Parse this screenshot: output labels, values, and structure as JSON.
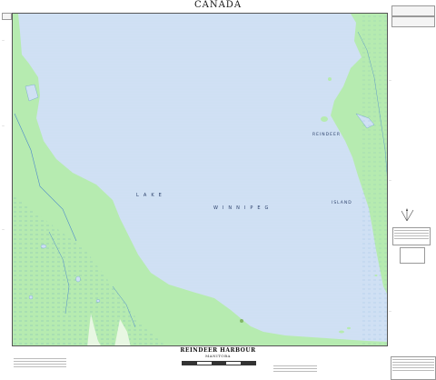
{
  "header": {
    "country": "CANADA"
  },
  "footer": {
    "title": "REINDEER HARBOUR",
    "province": "MANITOBA"
  },
  "map": {
    "labels": {
      "lake_word1": "LAKE",
      "lake_word2": "WINNIPEG",
      "reindeer": "REINDEER",
      "island": "ISLAND"
    },
    "colors": {
      "water": "#cfe0f3",
      "land": "#b6ebb0",
      "land_dark": "#9bd79a",
      "border": "#555555"
    }
  }
}
